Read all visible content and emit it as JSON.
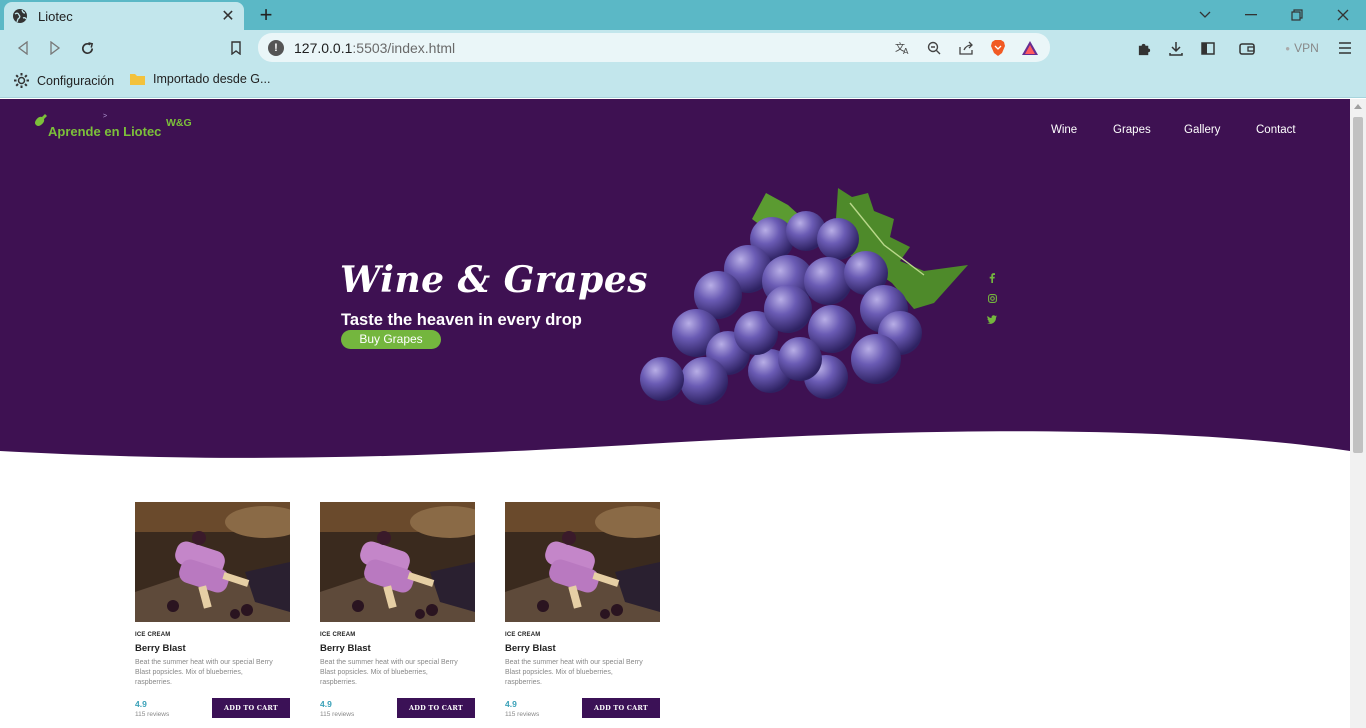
{
  "browser": {
    "tab_title": "Liotec",
    "tab_close": "✕",
    "new_tab": "+",
    "url_host": "127.0.0.1",
    "url_path": ":5503/index.html",
    "vpn_label": "VPN",
    "bookmarks": [
      {
        "label": "Configuración",
        "icon": "gear-icon"
      },
      {
        "label": "Importado desde G...",
        "icon": "folder-icon"
      }
    ],
    "colors": {
      "tabbar": "#5bb8c6",
      "toolbar": "#c2e6ec"
    }
  },
  "site": {
    "logo_text": "Aprende en Liotec",
    "logo_sup": "W&G",
    "logo_caret": ">",
    "nav": [
      "Wine",
      "Grapes",
      "Gallery",
      "Contact"
    ],
    "hero_title": "Wine & Grapes",
    "hero_subtitle": "Taste the heaven in every drop",
    "hero_button": "Buy Grapes",
    "social_icons": [
      "facebook-icon",
      "instagram-icon",
      "twitter-icon"
    ],
    "colors": {
      "hero_bg": "#3e1152",
      "accent": "#74b63e",
      "dark_button": "#3b1156",
      "rating": "#3aa1b8"
    }
  },
  "products": [
    {
      "category": "ICE CREAM",
      "name": "Berry Blast",
      "description": "Beat the summer heat with our special Berry Blast popsicles. Mix of blueberries, raspberries.",
      "rating": "4.9",
      "reviews": "115 reviews",
      "button": "ADD TO CART"
    },
    {
      "category": "ICE CREAM",
      "name": "Berry Blast",
      "description": "Beat the summer heat with our special Berry Blast popsicles. Mix of blueberries, raspberries.",
      "rating": "4.9",
      "reviews": "115 reviews",
      "button": "ADD TO CART"
    },
    {
      "category": "ICE CREAM",
      "name": "Berry Blast",
      "description": "Beat the summer heat with our special Berry Blast popsicles. Mix of blueberries, raspberries.",
      "rating": "4.9",
      "reviews": "115 reviews",
      "button": "ADD TO CART"
    }
  ]
}
